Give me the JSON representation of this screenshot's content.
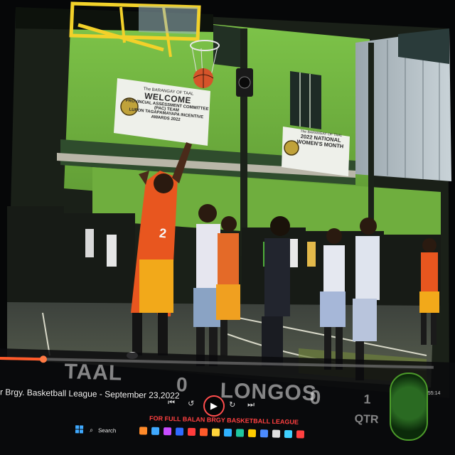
{
  "scene": {
    "banner_left": {
      "line1": "The BARANGAY OF TAAL",
      "line2": "WELCOME",
      "line3": "PROVINCIAL ASSESSMENT COMMITTEE (PAC) TEAM",
      "line4": "LUPON TAGAPAMAYAPA INCENTIVE AWARDS 2022"
    },
    "banner_right": {
      "line1": "The BARANGAY OF TAAL",
      "line2": "2022 NATIONAL WOMEN'S MONTH"
    },
    "jersey_number": "2"
  },
  "video_player": {
    "caption": "r Brgy. Basketball League - September 23,2022",
    "progress": 0.1,
    "scoreboard": {
      "home_team": "TAAL",
      "home_score": "0",
      "away_team": "LONGOS",
      "away_score": "0",
      "period": "1",
      "period_label": "QTR"
    },
    "controls": {
      "prev_icon": "skip-back-icon",
      "rewind_icon": "rewind-icon",
      "play_icon": "play-icon",
      "forward_icon": "forward-icon",
      "next_icon": "skip-forward-icon"
    },
    "time_readout": "4:55:14",
    "footer_text": "FOR FULL BALAN BRGY BASKETBALL LEAGUE"
  },
  "taskbar": {
    "search_label": "Search",
    "app_colors": [
      "#ff8a2a",
      "#3fa9ff",
      "#c84cff",
      "#2f6bff",
      "#ff3b3b",
      "#ff5a2a",
      "#ffd43b",
      "#2fb1ff",
      "#1ec7a0",
      "#ffcc00",
      "#4c8bff",
      "#e0e0e0",
      "#3fd0ff",
      "#ff4040"
    ]
  },
  "colors": {
    "progress": "#ff5a2a",
    "wall": "#8ad14a",
    "court": "#4a5148"
  }
}
